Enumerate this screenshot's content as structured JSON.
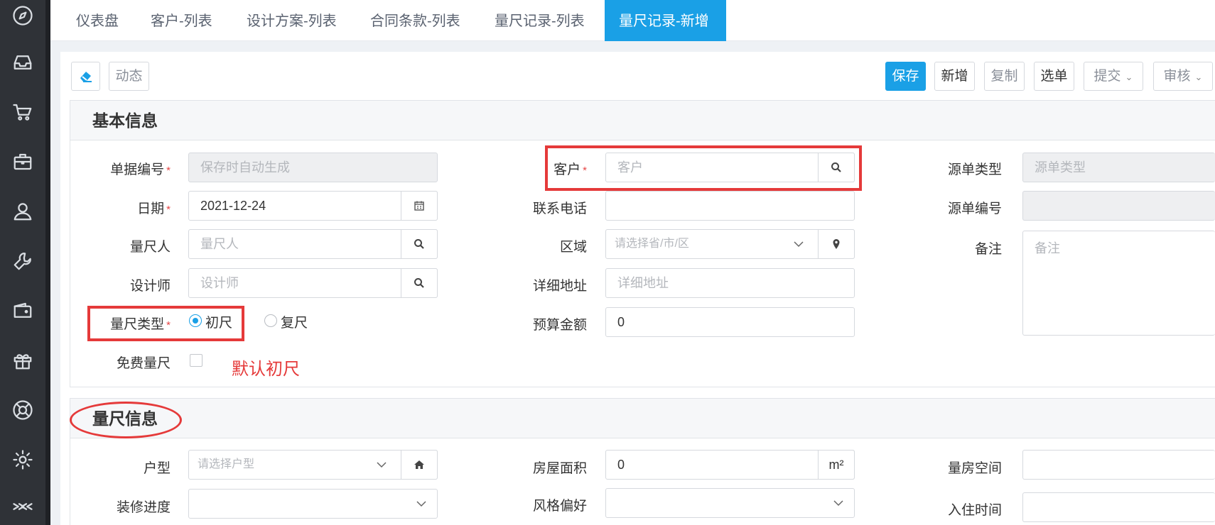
{
  "tabs": {
    "items": [
      "仪表盘",
      "客户-列表",
      "设计方案-列表",
      "合同条款-列表",
      "量尺记录-列表"
    ],
    "active": "量尺记录-新增",
    "close": "✖"
  },
  "toolbar": {
    "activity": "动态",
    "save": "保存",
    "new": "新增",
    "copy": "复制",
    "select": "选单",
    "submit": "提交",
    "audit": "审核"
  },
  "basic": {
    "title": "基本信息",
    "doc_no": {
      "label": "单据编号",
      "placeholder": "保存时自动生成"
    },
    "date": {
      "label": "日期",
      "value": "2021-12-24"
    },
    "measurer": {
      "label": "量尺人",
      "placeholder": "量尺人"
    },
    "designer": {
      "label": "设计师",
      "placeholder": "设计师"
    },
    "measure_type": {
      "label": "量尺类型",
      "options": [
        "初尺",
        "复尺"
      ],
      "selected": "初尺"
    },
    "free": {
      "label": "免费量尺",
      "checked": false
    },
    "customer": {
      "label": "客户",
      "placeholder": "客户"
    },
    "phone": {
      "label": "联系电话",
      "value": ""
    },
    "region": {
      "label": "区域",
      "placeholder": "请选择省/市/区"
    },
    "address": {
      "label": "详细地址",
      "placeholder": "详细地址"
    },
    "budget": {
      "label": "预算金额",
      "value": "0"
    },
    "source_type": {
      "label": "源单类型",
      "placeholder": "源单类型"
    },
    "source_no": {
      "label": "源单编号",
      "value": ""
    },
    "remark": {
      "label": "备注",
      "placeholder": "备注"
    }
  },
  "measure": {
    "title": "量尺信息",
    "house_type": {
      "label": "户型",
      "placeholder": "请选择户型"
    },
    "progress": {
      "label": "装修进度",
      "value": ""
    },
    "area": {
      "label": "房屋面积",
      "value": "0",
      "unit": "m²"
    },
    "style": {
      "label": "风格偏好",
      "value": ""
    },
    "space": {
      "label": "量房空间",
      "value": ""
    },
    "move_in": {
      "label": "入住时间",
      "value": ""
    }
  },
  "annotation": "默认初尺",
  "colors": {
    "accent": "#1aa0e6",
    "annotation": "#e53a3a",
    "rail": "#2f3237"
  },
  "rail_icons": [
    "compass-icon",
    "inbox-icon",
    "cart-icon",
    "briefcase-icon",
    "user-icon",
    "wrench-icon",
    "wallet-icon",
    "gift-icon",
    "lifebuoy-icon",
    "gear-icon",
    "collapse-icon"
  ]
}
